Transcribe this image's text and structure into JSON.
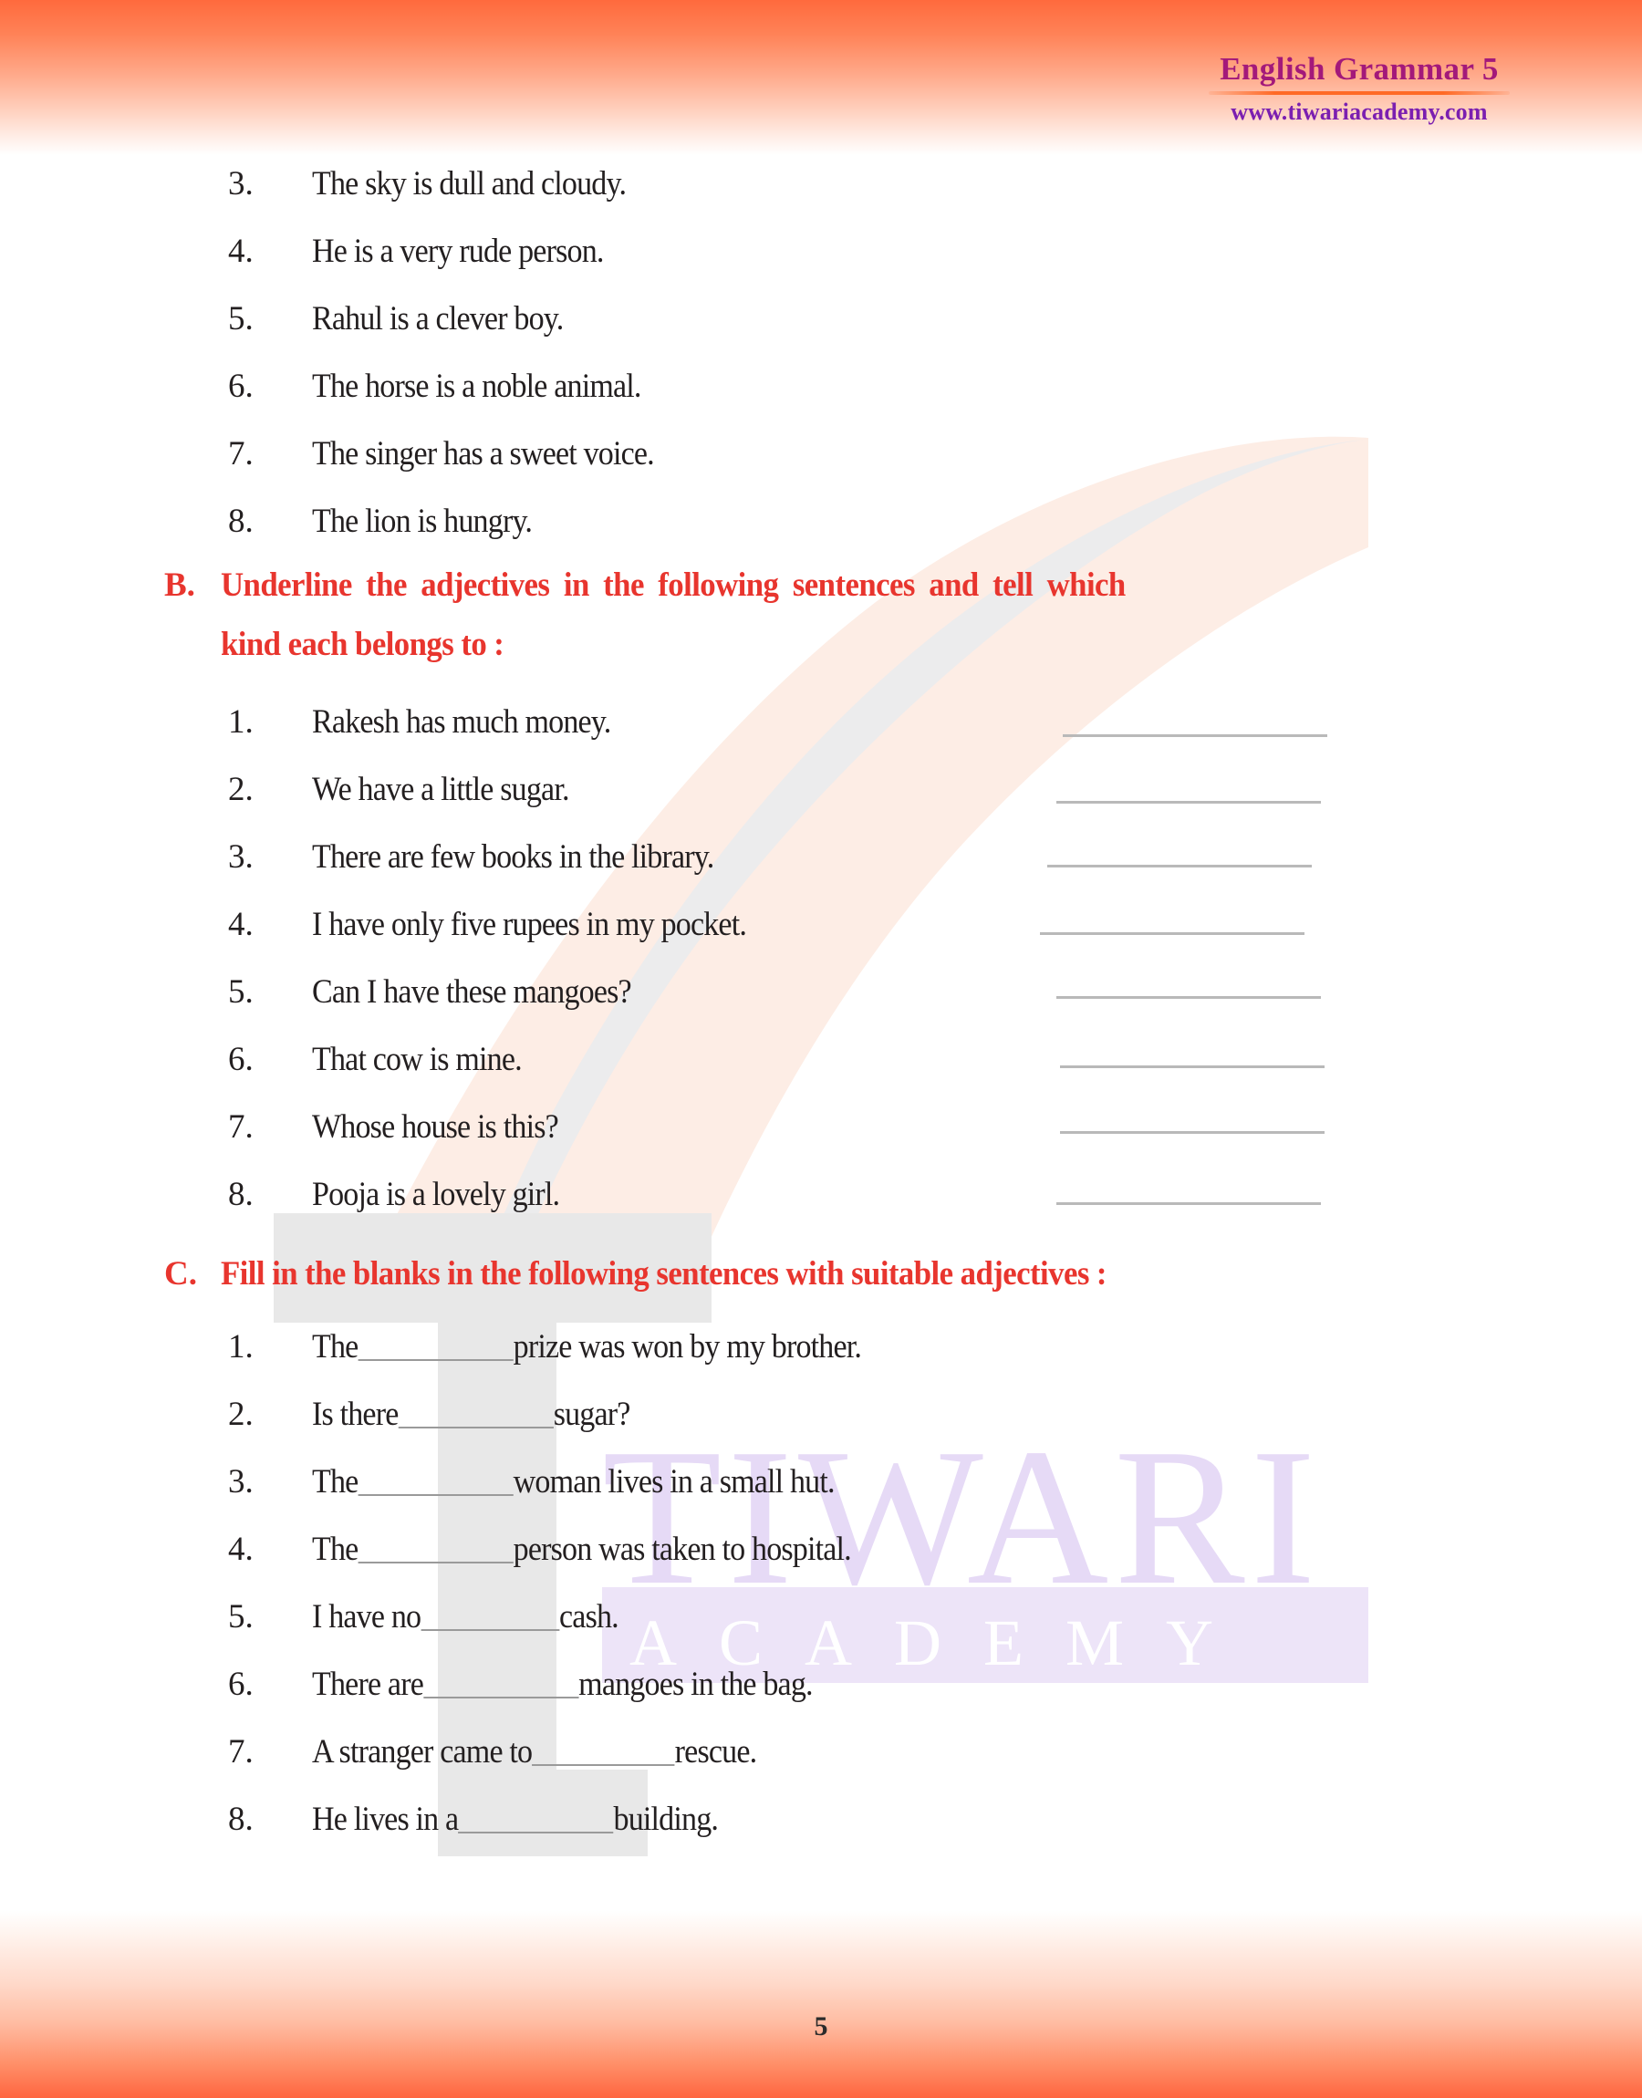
{
  "header": {
    "title": "English Grammar 5",
    "site": "www.tiwariacademy.com"
  },
  "watermark": {
    "brand_top": "TIWARI",
    "brand_bottom": "ACADEMY",
    "mark_letter": "T",
    "colors": {
      "brand_top": "#E6DAF6",
      "brand_band": "#EDE4F8",
      "brand_bottom_text": "#FFFFFF",
      "mark_letter": "#E6E6E6",
      "swoosh": "#FDEDE5"
    }
  },
  "colors": {
    "heading_red": "#E8352E",
    "title_purple": "#A3197A",
    "site_purple": "#7B1FB0",
    "band_orange": "#FF6A3D",
    "body_text": "#231F20",
    "rule_grey": "#B9B9B9"
  },
  "continued_list": {
    "items": [
      {
        "num": "3.",
        "text": "The sky is dull and cloudy."
      },
      {
        "num": "4.",
        "text": "He is a very rude person."
      },
      {
        "num": "5.",
        "text": "Rahul is a clever boy."
      },
      {
        "num": "6.",
        "text": "The horse is a noble animal."
      },
      {
        "num": "7.",
        "text": "The singer has a sweet voice."
      },
      {
        "num": "8.",
        "text": "The lion is hungry."
      }
    ]
  },
  "section_b": {
    "letter": "B.",
    "title_line1": "Underline the adjectives in the following sentences and tell which",
    "title_line2": "kind each belongs to :",
    "items": [
      {
        "num": "1.",
        "text": "Rakesh has much money."
      },
      {
        "num": "2.",
        "text": "We have a little sugar."
      },
      {
        "num": "3.",
        "text": "There are few books in the library."
      },
      {
        "num": "4.",
        "text": "I have only five rupees in my pocket."
      },
      {
        "num": "5.",
        "text": "Can I have these mangoes?"
      },
      {
        "num": "6.",
        "text": "That cow is mine."
      },
      {
        "num": "7.",
        "text": "Whose house is this?"
      },
      {
        "num": "8.",
        "text": "Pooja is a lovely girl."
      }
    ]
  },
  "section_c": {
    "letter": "C.",
    "title": "Fill in the blanks in the following sentences with suitable adjectives :",
    "items": [
      {
        "num": "1.",
        "before": "The",
        "after": "prize was won by my brother.",
        "blank_width": 185
      },
      {
        "num": "2.",
        "before": "Is there",
        "after": "sugar?",
        "blank_width": 185
      },
      {
        "num": "3.",
        "before": "The",
        "after": "woman lives in a small hut.",
        "blank_width": 185
      },
      {
        "num": "4.",
        "before": "The",
        "after": "person was taken to hospital.",
        "blank_width": 185
      },
      {
        "num": "5.",
        "before": "I have no",
        "after": "cash.",
        "blank_width": 165
      },
      {
        "num": "6.",
        "before": "There are",
        "after": "mangoes in the bag.",
        "blank_width": 185
      },
      {
        "num": "7.",
        "before": "A stranger came to",
        "after": "rescue.",
        "blank_width": 170
      },
      {
        "num": "8.",
        "before": "He lives in a",
        "after": "building.",
        "blank_width": 185
      }
    ]
  },
  "footer": {
    "page_number": "5"
  }
}
